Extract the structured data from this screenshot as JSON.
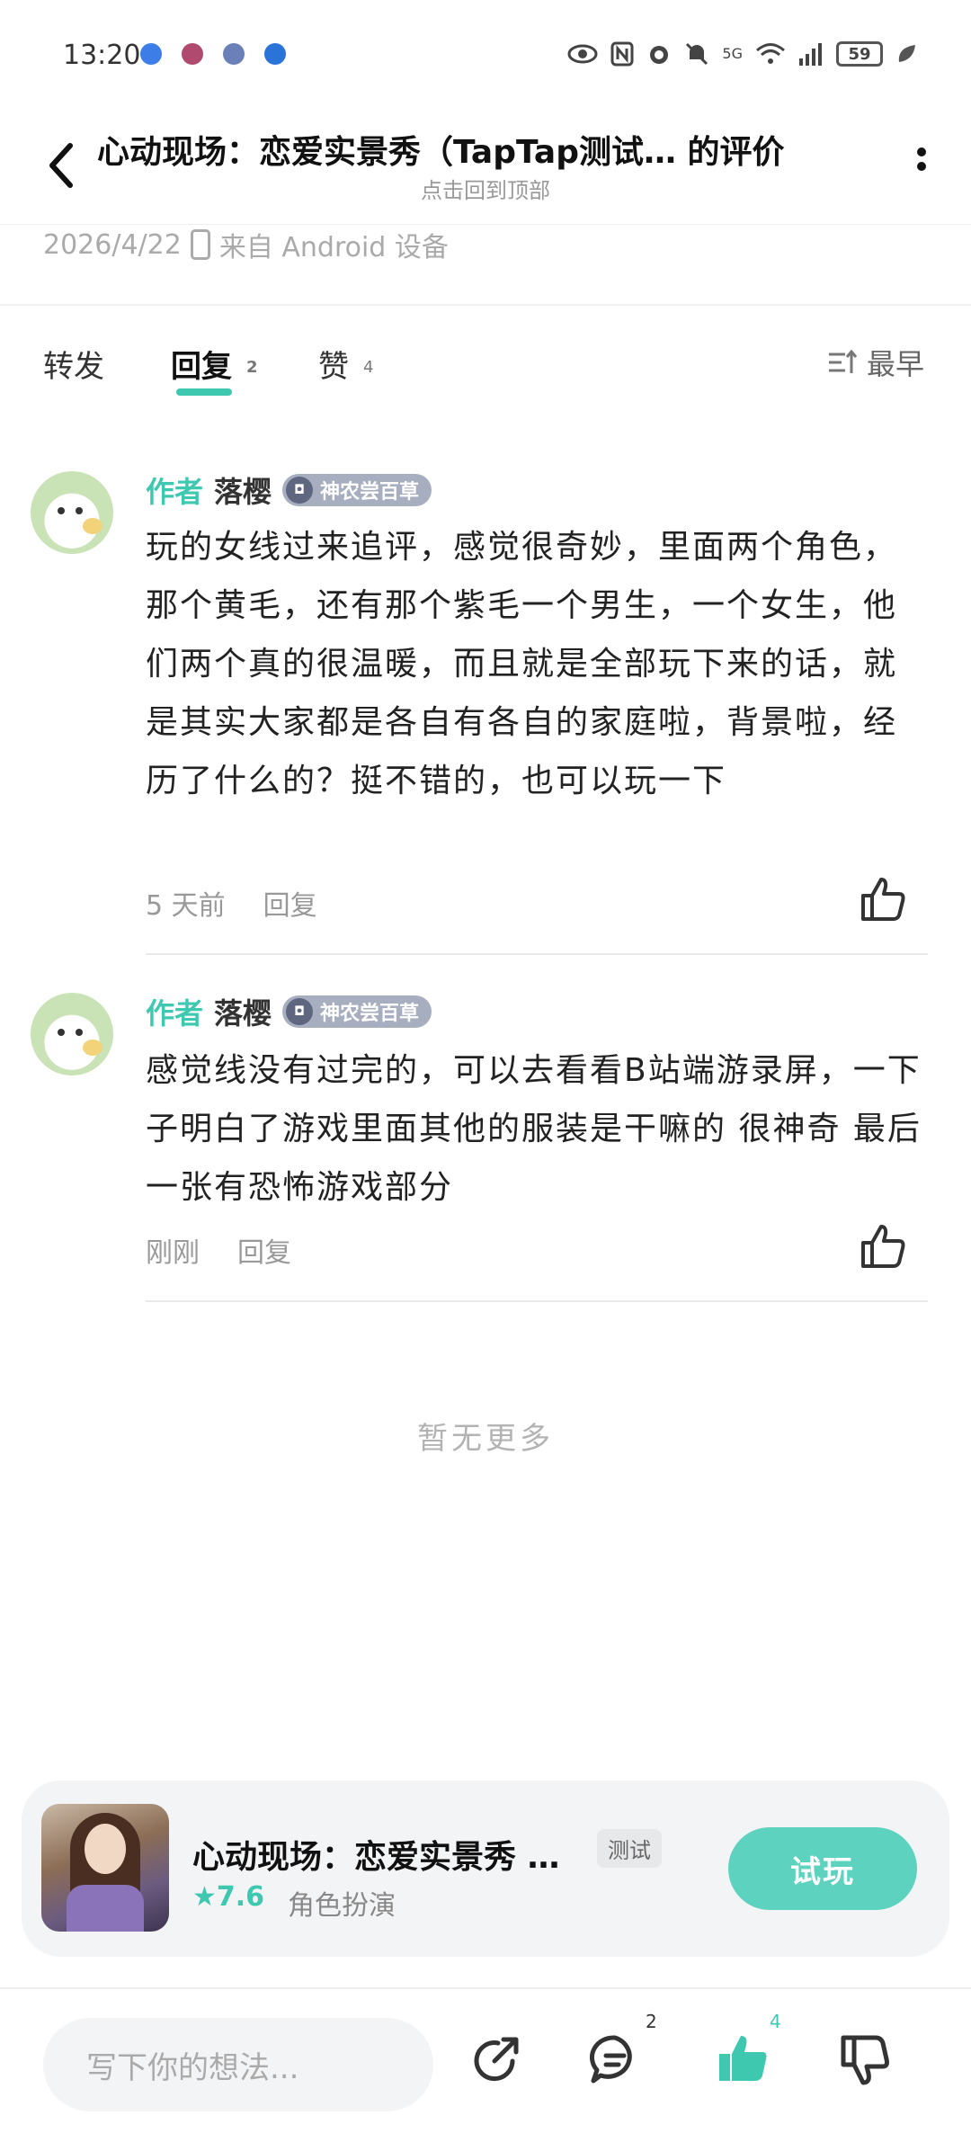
{
  "status_bar": {
    "time": "13:20",
    "battery": "59",
    "network": "5G",
    "left_icons": [
      "bluetooth-icon",
      "app-icon-1",
      "app-icon-2",
      "browser-icon"
    ],
    "right_icons": [
      "eye-icon",
      "nfc-icon",
      "alarm-icon",
      "mute-icon",
      "wifi-icon",
      "signal-icon",
      "battery-icon",
      "leaf-icon"
    ]
  },
  "header": {
    "title": "心动现场：恋爱实景秀（TapTap测试…   的评价",
    "subtitle": "点击回到顶部"
  },
  "post_meta": {
    "date": "2026/4/22",
    "device": "来自 Android 设备"
  },
  "tabs": [
    {
      "label": "转发",
      "count": ""
    },
    {
      "label": "回复",
      "count": "2"
    },
    {
      "label": "赞",
      "count": "4"
    }
  ],
  "sort": {
    "label": "最早"
  },
  "comments": [
    {
      "author_tag": "作者",
      "author_name": "落樱",
      "badge": "神农尝百草",
      "text": "玩的女线过来追评，感觉很奇妙，里面两个角色，那个黄毛，还有那个紫毛一个男生，一个女生，他们两个真的很温暖，而且就是全部玩下来的话，就是其实大家都是各自有各自的家庭啦，背景啦，经历了什么的？挺不错的，也可以玩一下",
      "time": "5 天前",
      "reply_label": "回复"
    },
    {
      "author_tag": "作者",
      "author_name": "落樱",
      "badge": "神农尝百草",
      "text": "感觉线没有过完的，可以去看看B站端游录屏，一下子明白了游戏里面其他的服装是干嘛的 很神奇 最后一张有恐怖游戏部分",
      "time": "刚刚",
      "reply_label": "回复"
    }
  ],
  "no_more": "暂无更多",
  "game_card": {
    "title": "心动现场：恋爱实景秀 …",
    "tag": "测试",
    "rating": "★7.6",
    "genre": "角色扮演",
    "button": "试玩"
  },
  "bottom_bar": {
    "input_placeholder": "写下你的想法...",
    "comment_count": "2",
    "like_count": "4"
  },
  "colors": {
    "accent": "#3fc8b0",
    "button": "#5dd3bf",
    "badge": "#a7aebf"
  }
}
